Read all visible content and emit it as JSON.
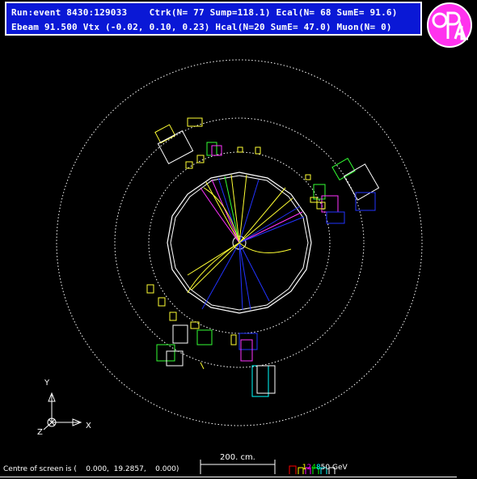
{
  "header": {
    "line1": "Run:event 8430:129033    Ctrk(N= 77 Sump=118.1) Ecal(N= 68 SumE= 91.6)",
    "line2": "Ebeam 91.500 Vtx (-0.02, 0.10, 0.23) Hcal(N=20 SumE= 47.0) Muon(N= 0)"
  },
  "logo": {
    "text": "OPAL",
    "fill": "#ff33ee",
    "ring": "#ffffff"
  },
  "axes": {
    "y": "Y",
    "x": "X",
    "z": "Z"
  },
  "scale": {
    "label": "200. cm."
  },
  "energy_legend": {
    "values": [
      "1",
      "2",
      "4",
      "8",
      "50"
    ],
    "unit": "GeV",
    "colors": [
      "#ffff00",
      "#ff00ff",
      "#00ff00",
      "#00ffff",
      "#ffffff"
    ]
  },
  "footer": {
    "centre_text": "Centre of screen is (    0.000,  19.2857,    0.000)"
  },
  "colors": {
    "background": "#000000",
    "header_bg": "#0a18d6",
    "track_blue": "#2233ff",
    "track_yellow": "#ffff33",
    "track_green": "#33ff33",
    "track_magenta": "#ff33ff",
    "detector": "#ffffff"
  }
}
